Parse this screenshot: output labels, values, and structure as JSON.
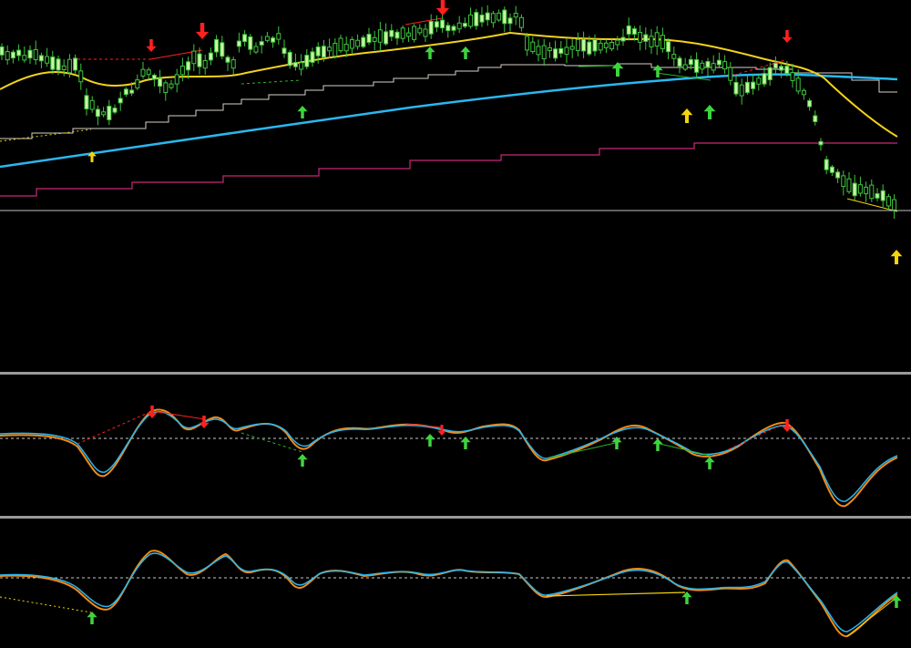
{
  "colors": {
    "background": "#000000",
    "bull_candle": "#c8f5a0",
    "bear_candle": "#000000",
    "wick": "#3fc53f",
    "ma_fast": "#f2d21b",
    "ma_slow": "#2ab7f0",
    "stair_upper": "#d8d0c8",
    "stair_lower": "#d0287a",
    "arrow_up": "#3fd43f",
    "arrow_up_alt": "#f5d40a",
    "arrow_down": "#ff2020",
    "osc_orange": "#f08a14",
    "osc_blue": "#2ab7f0",
    "divergence_red": "#ff2020",
    "divergence_green": "#28b428",
    "divergence_yellow": "#f5d40a",
    "separator": "#9a9a9a",
    "baseline": "#c0c0c0"
  },
  "icons": {
    "buy_signal": "arrow-up-icon",
    "sell_signal": "arrow-down-icon"
  },
  "panels": {
    "price": {
      "name": "price-panel"
    },
    "oscillator_1": {
      "name": "oscillator-panel-1"
    },
    "oscillator_2": {
      "name": "oscillator-panel-2"
    }
  }
}
